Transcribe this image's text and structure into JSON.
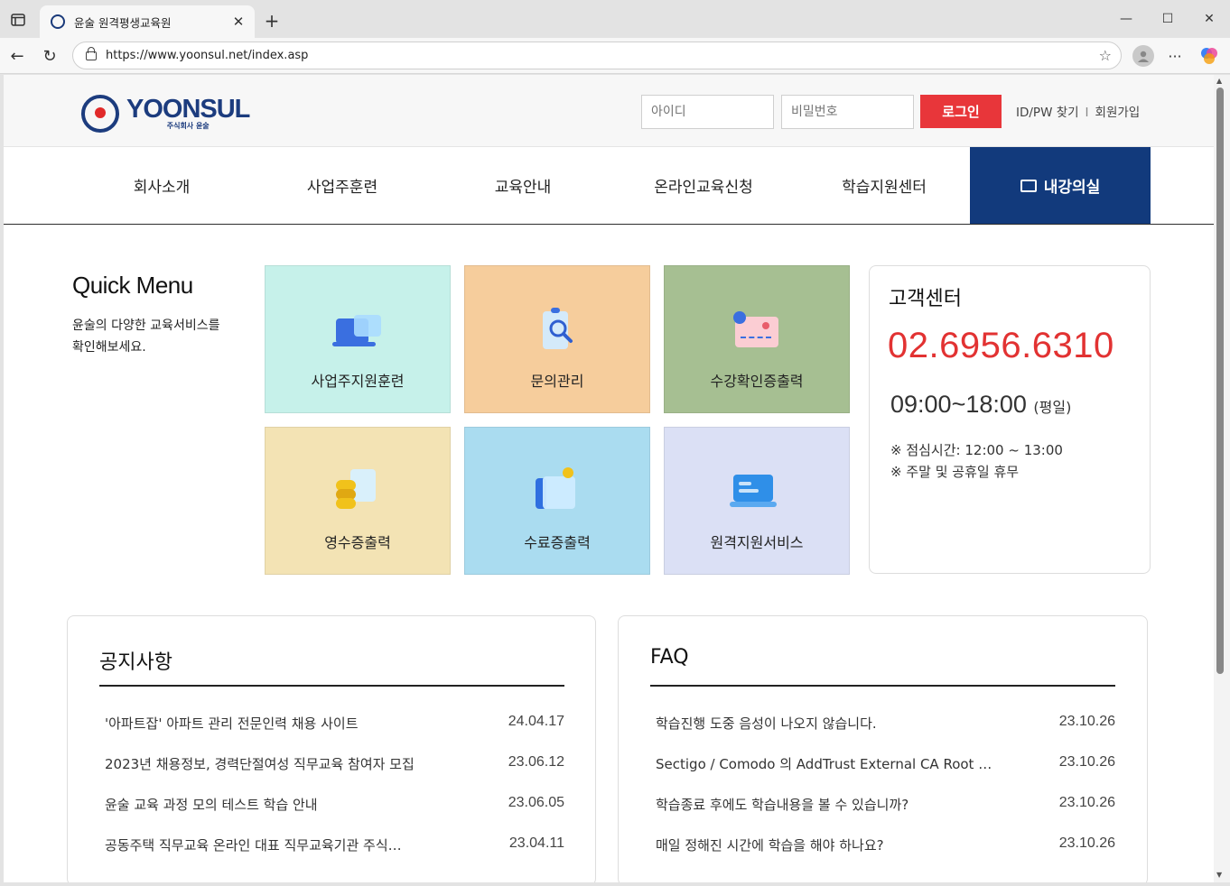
{
  "browser": {
    "tab_title": "윤술 원격평생교육원",
    "url": "https://www.yoonsul.net/index.asp"
  },
  "site": {
    "logo_name": "YOONSUL",
    "logo_sub": "주식회사 윤술",
    "login": {
      "id_placeholder": "아이디",
      "pw_placeholder": "비밀번호",
      "button": "로그인",
      "find": "ID/PW 찾기",
      "sep": "I",
      "join": "회원가입"
    },
    "gnb": [
      "회사소개",
      "사업주훈련",
      "교육안내",
      "온라인교육신청",
      "학습지원센터"
    ],
    "gnb_lecture": "내강의실",
    "quick": {
      "title": "Quick Menu",
      "desc1": "윤술의 다양한 교육서비스를",
      "desc2": "확인해보세요.",
      "items": [
        {
          "label": "사업주지원훈련",
          "color": "#c6f1ea"
        },
        {
          "label": "문의관리",
          "color": "#f6cd9c"
        },
        {
          "label": "수강확인증출력",
          "color": "#a6bf92"
        },
        {
          "label": "영수증출력",
          "color": "#f3e3b4"
        },
        {
          "label": "수료증출력",
          "color": "#aadcf0"
        },
        {
          "label": "원격지원서비스",
          "color": "#dbe0f5"
        }
      ]
    },
    "cs": {
      "title": "고객센터",
      "tel": "02.6956.6310",
      "hours": "09:00~18:00",
      "hours_note": "(평일)",
      "note1": "※ 점심시간: 12:00 ~ 13:00",
      "note2": "※ 주말 및 공휴일 휴무"
    },
    "notice": {
      "title": "공지사항",
      "rows": [
        {
          "text": "'아파트잡' 아파트 관리 전문인력 채용 사이트",
          "date": "24.04.17"
        },
        {
          "text": "2023년 채용정보, 경력단절여성 직무교육 참여자 모집",
          "date": "23.06.12"
        },
        {
          "text": "윤술 교육 과정 모의 테스트 학습 안내",
          "date": "23.06.05"
        },
        {
          "text": "공동주택 직무교육 온라인 대표 직무교육기관 주식…",
          "date": "23.04.11"
        }
      ]
    },
    "faq": {
      "title": "FAQ",
      "rows": [
        {
          "text": "학습진행 도중 음성이 나오지 않습니다.",
          "date": "23.10.26"
        },
        {
          "text": "Sectigo / Comodo 의 AddTrust External CA Root …",
          "date": "23.10.26"
        },
        {
          "text": "학습종료 후에도 학습내용을 볼 수 있습니까?",
          "date": "23.10.26"
        },
        {
          "text": "매일 정해진 시간에 학습을 해야 하나요?",
          "date": "23.10.26"
        }
      ]
    }
  }
}
